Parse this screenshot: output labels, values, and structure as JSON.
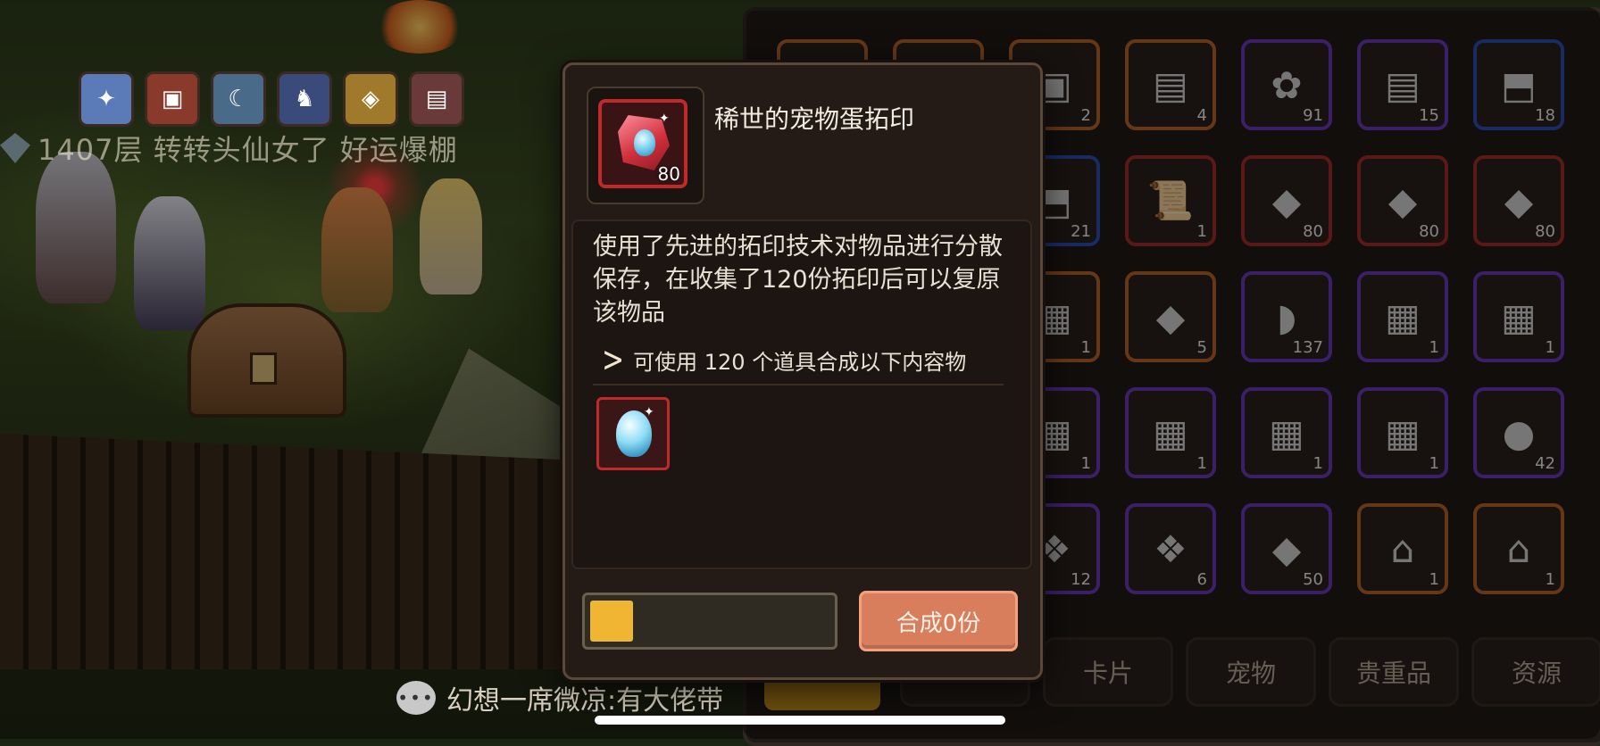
{
  "world": {
    "guild_text": "1407层 转转头仙女了 好运爆棚"
  },
  "chat": {
    "icon": "speech-bubble-icon",
    "message": "幻想一席微凉:有大佬带"
  },
  "inventory": {
    "tabs": [
      "卡片",
      "宠物",
      "贵重品",
      "资源"
    ],
    "slots": [
      {
        "color": "orange",
        "count": "",
        "icon": "?"
      },
      {
        "color": "orange",
        "count": "",
        "icon": "?"
      },
      {
        "color": "orange",
        "count": "2",
        "icon": "▣"
      },
      {
        "color": "orange",
        "count": "4",
        "icon": "▤"
      },
      {
        "color": "purple",
        "count": "91",
        "icon": "✿"
      },
      {
        "color": "purple",
        "count": "15",
        "icon": "▤"
      },
      {
        "color": "blue",
        "count": "18",
        "icon": "⬒"
      },
      {
        "color": "gray",
        "count": "",
        "icon": ""
      },
      {
        "color": "gray",
        "count": "",
        "icon": ""
      },
      {
        "color": "blue",
        "count": "21",
        "icon": "⬒"
      },
      {
        "color": "red",
        "count": "1",
        "icon": "📜"
      },
      {
        "color": "red",
        "count": "80",
        "icon": "◆"
      },
      {
        "color": "red",
        "count": "80",
        "icon": "◆"
      },
      {
        "color": "red",
        "count": "80",
        "icon": "◆"
      },
      {
        "color": "gray",
        "count": "",
        "icon": ""
      },
      {
        "color": "gray",
        "count": "",
        "icon": ""
      },
      {
        "color": "orange",
        "count": "1",
        "icon": "▦"
      },
      {
        "color": "orange",
        "count": "5",
        "icon": "◆"
      },
      {
        "color": "purple",
        "count": "137",
        "icon": "◗"
      },
      {
        "color": "purple",
        "count": "1",
        "icon": "▦"
      },
      {
        "color": "purple",
        "count": "1",
        "icon": "▦"
      },
      {
        "color": "gray",
        "count": "",
        "icon": ""
      },
      {
        "color": "gray",
        "count": "",
        "icon": ""
      },
      {
        "color": "purple",
        "count": "1",
        "icon": "▦"
      },
      {
        "color": "purple",
        "count": "1",
        "icon": "▦"
      },
      {
        "color": "purple",
        "count": "1",
        "icon": "▦"
      },
      {
        "color": "purple",
        "count": "1",
        "icon": "▦"
      },
      {
        "color": "purple",
        "count": "42",
        "icon": "●"
      },
      {
        "color": "gray",
        "count": "",
        "icon": ""
      },
      {
        "color": "gray",
        "count": "",
        "icon": ""
      },
      {
        "color": "purple",
        "count": "12",
        "icon": "❖"
      },
      {
        "color": "purple",
        "count": "6",
        "icon": "❖"
      },
      {
        "color": "purple",
        "count": "50",
        "icon": "◆"
      },
      {
        "color": "orange",
        "count": "1",
        "icon": "⌂"
      },
      {
        "color": "orange",
        "count": "1",
        "icon": "⌂"
      }
    ]
  },
  "modal": {
    "item_name": "稀世的宠物蛋拓印",
    "item_count": "80",
    "description": "使用了先进的拓印技术对物品进行分散保存，在收集了120份拓印后可以复原该物品",
    "craft_hint": "可使用 120 个道具合成以下内容物",
    "progress": 0.1,
    "craft_button": "合成0份"
  }
}
